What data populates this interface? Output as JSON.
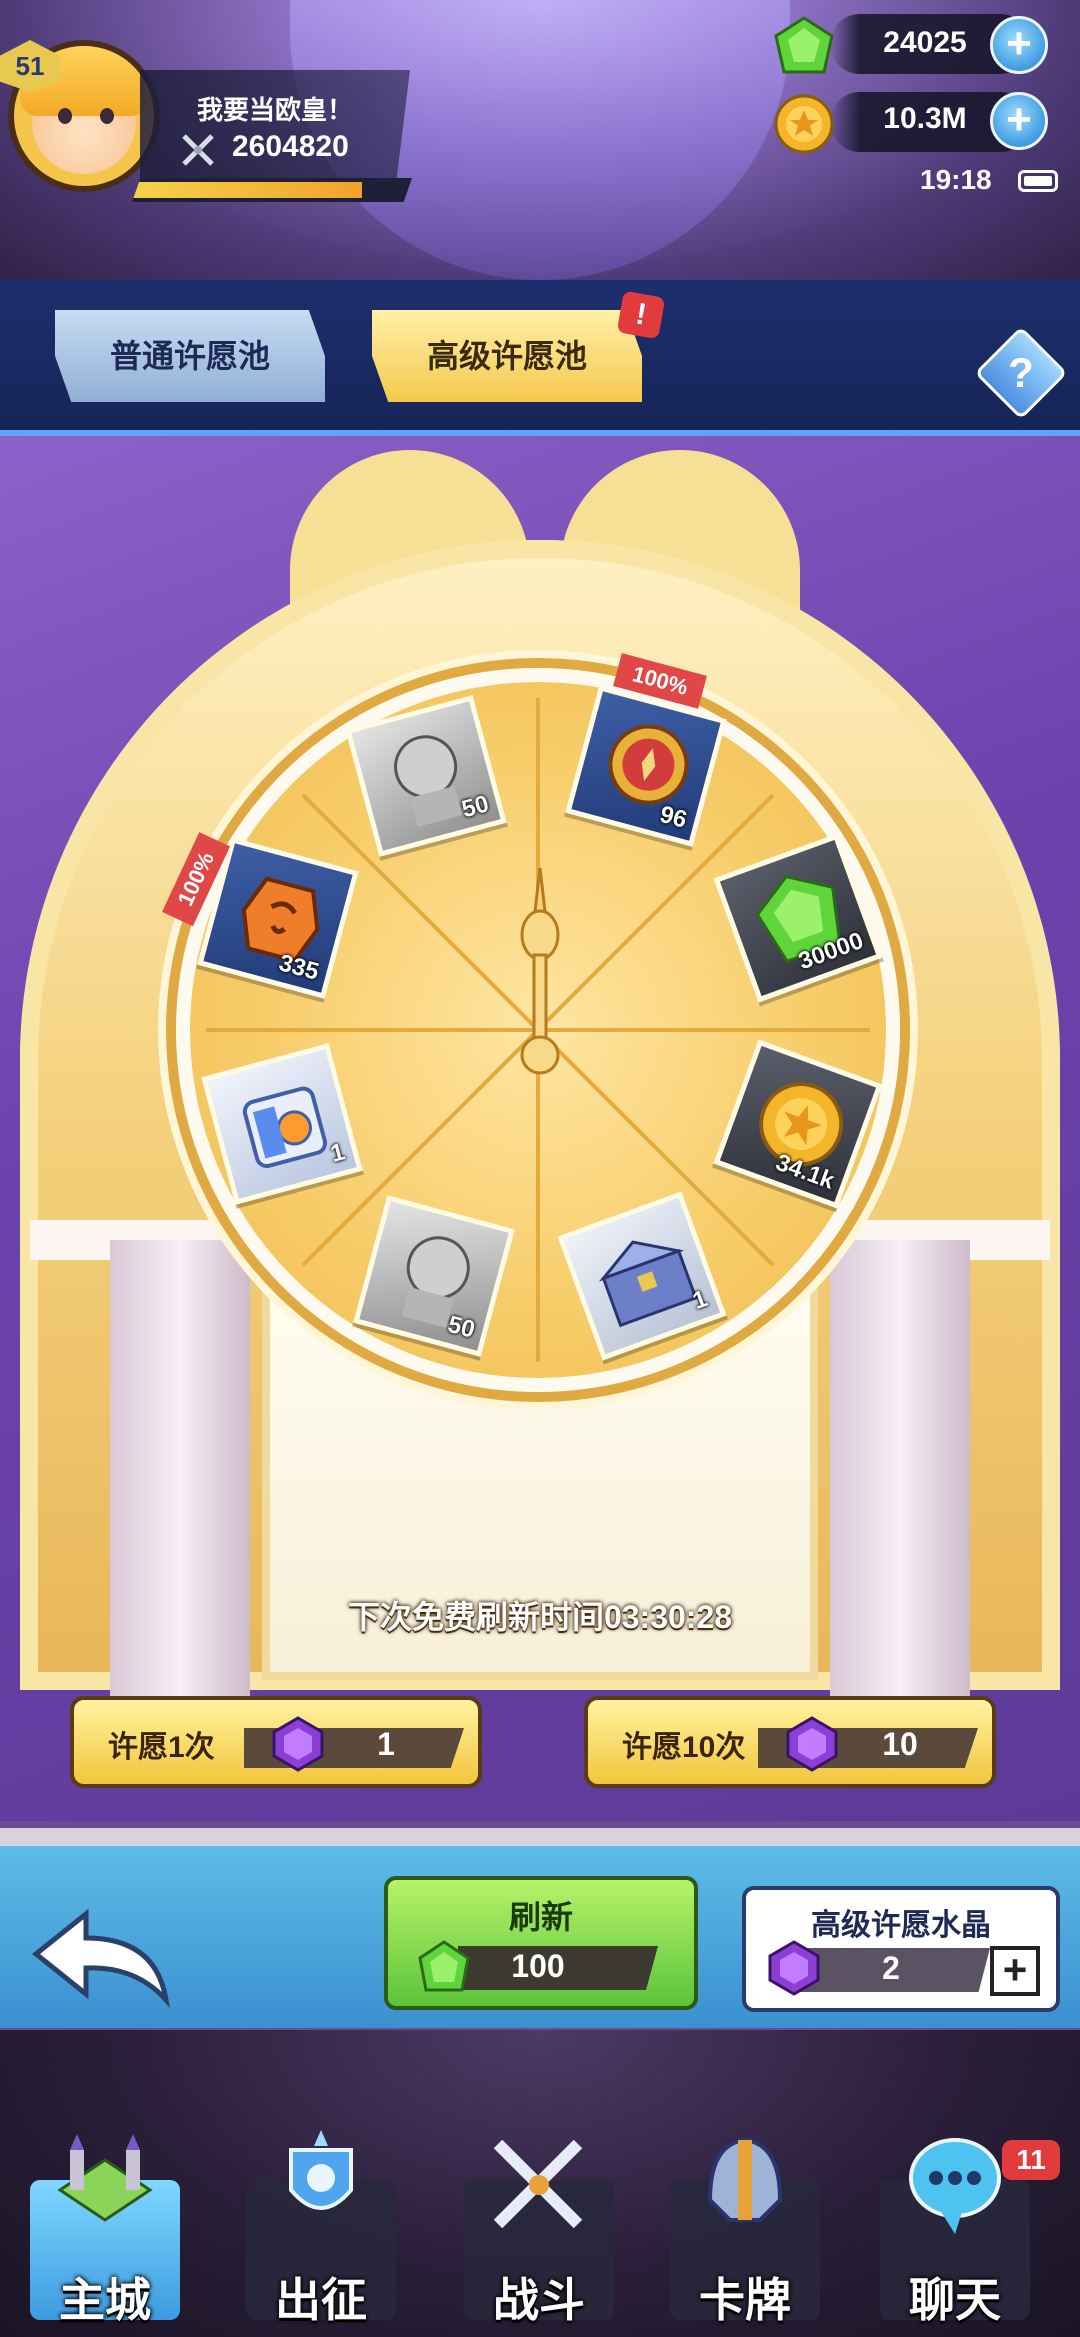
{
  "player": {
    "level": "51",
    "name": "我要当欧皇！",
    "power": "2604820",
    "xp_fraction": 0.82
  },
  "resources": {
    "gems": "24025",
    "gold": "10.3M",
    "plus_symbol": "+"
  },
  "status": {
    "time": "19:18"
  },
  "tabs": {
    "normal": "普通许愿池",
    "advanced": "高级许愿池",
    "alert": "!",
    "help": "?"
  },
  "wheel": {
    "prizes": [
      {
        "name": "hero-card-50",
        "qty": "50"
      },
      {
        "name": "emblem-96",
        "qty": "96",
        "ribbon": "100%"
      },
      {
        "name": "gem-30000",
        "qty": "30000"
      },
      {
        "name": "gold-34.1k",
        "qty": "34.1k"
      },
      {
        "name": "chest-1",
        "qty": "1"
      },
      {
        "name": "hero-card-50b",
        "qty": "50"
      },
      {
        "name": "device-1",
        "qty": "1"
      },
      {
        "name": "rune-335",
        "qty": "335",
        "ribbon": "100%"
      }
    ]
  },
  "refresh_timer": "下次免费刷新时间03:30:28",
  "wish": {
    "once_label": "许愿1次",
    "once_cost": "1",
    "ten_label": "许愿10次",
    "ten_cost": "10"
  },
  "refresh": {
    "label": "刷新",
    "cost": "100"
  },
  "crystal": {
    "title": "高级许愿水晶",
    "count": "2",
    "add": "+"
  },
  "nav": {
    "items": [
      {
        "label": "主城"
      },
      {
        "label": "出征"
      },
      {
        "label": "战斗"
      },
      {
        "label": "卡牌"
      },
      {
        "label": "聊天"
      }
    ],
    "chat_badge": "11"
  },
  "colors": {
    "accent_blue": "#3f9ce0",
    "gold": "#f3c53c",
    "alert_red": "#e23b3b"
  }
}
